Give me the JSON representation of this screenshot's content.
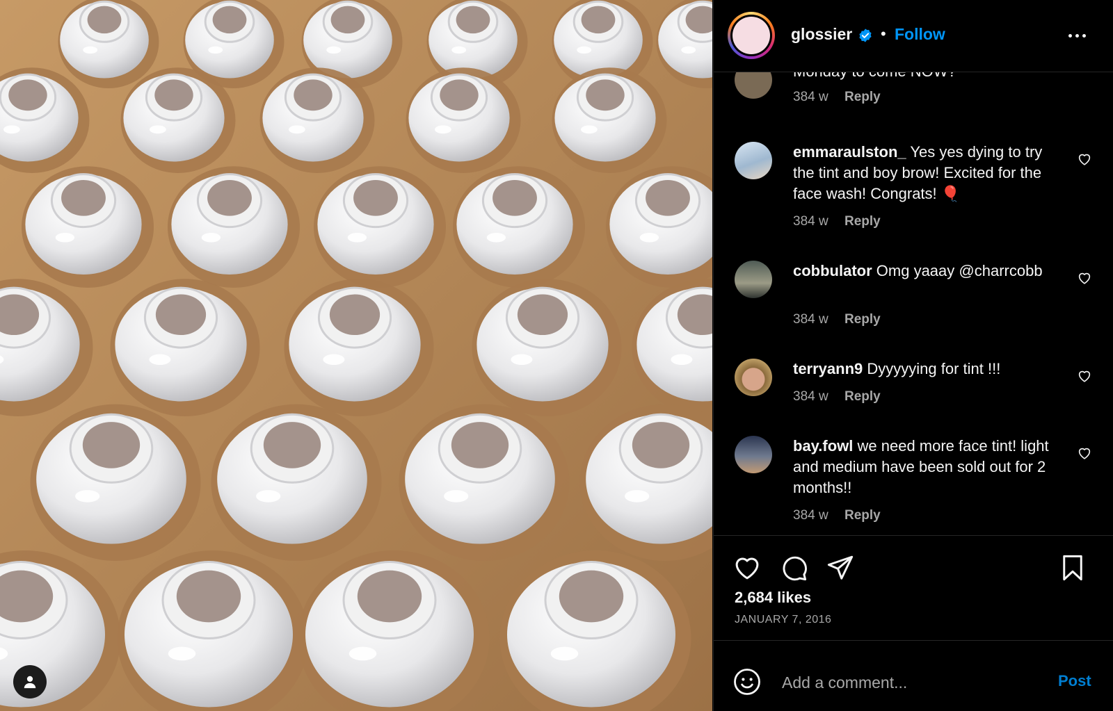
{
  "post": {
    "username": "glossier",
    "separator": "•",
    "follow_label": "Follow",
    "verified_icon": "verified-badge-icon",
    "more_icon": "more-options-icon"
  },
  "comments": [
    {
      "username": "",
      "text": "Monday to come NOW?",
      "age": "384 w",
      "reply_label": "Reply"
    },
    {
      "username": "emmaraulston_",
      "text": " Yes yes dying to try the tint and boy brow! Excited for the face wash! Congrats! 🎈",
      "age": "384 w",
      "reply_label": "Reply"
    },
    {
      "username": "cobbulator",
      "text": " Omg yaaay @charrcobb",
      "age": "384 w",
      "reply_label": "Reply"
    },
    {
      "username": "terryann9",
      "text": " Dyyyyying for tint !!!",
      "age": "384 w",
      "reply_label": "Reply"
    },
    {
      "username": "bay.fowl",
      "text": " we need more face tint! light and medium have been sold out for 2 months!!",
      "age": "384 w",
      "reply_label": "Reply"
    }
  ],
  "stats": {
    "likes": "2,684 likes",
    "date": "JANUARY 7, 2016"
  },
  "composer": {
    "placeholder": "Add a comment...",
    "post_label": "Post"
  },
  "colors": {
    "accent": "#0095f6",
    "background": "#000000",
    "secondary_text": "#a8a8a8",
    "divider": "#262626"
  }
}
